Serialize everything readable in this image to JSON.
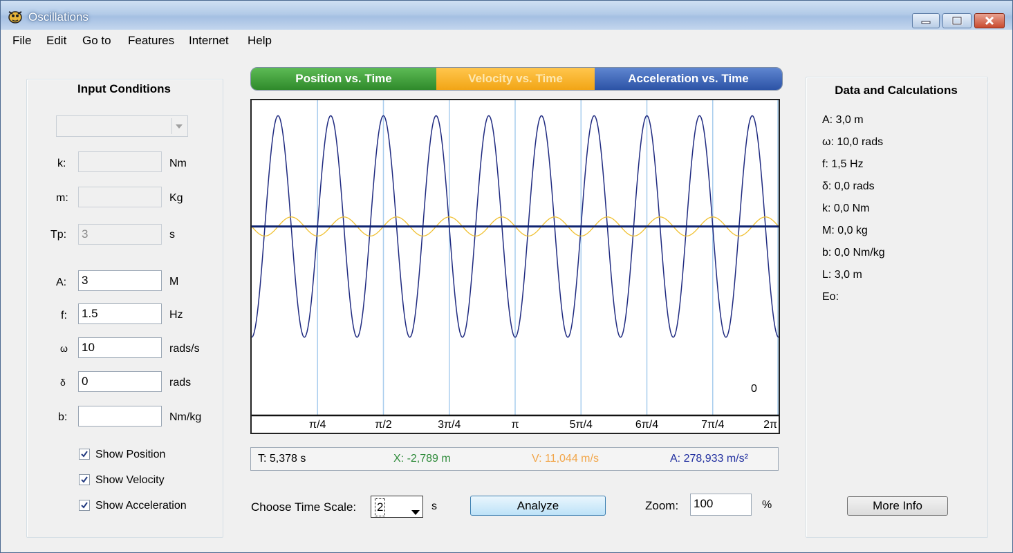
{
  "window": {
    "title": "Oscillations"
  },
  "menu": [
    "File",
    "Edit",
    "Go to",
    "Features",
    "Internet",
    "Help"
  ],
  "input_panel": {
    "title": "Input Conditions",
    "fields": [
      {
        "label": "k:",
        "value": "",
        "unit": "Nm"
      },
      {
        "label": "m:",
        "value": "",
        "unit": "Kg"
      },
      {
        "label": "Tp:",
        "value": "3",
        "unit": "s"
      },
      {
        "label": "A:",
        "value": "3",
        "unit": "M"
      },
      {
        "label": "f:",
        "value": "1.5",
        "unit": "Hz"
      },
      {
        "label": "ω",
        "value": "10",
        "unit": "rads/s"
      },
      {
        "label": "δ",
        "value": "0",
        "unit": "rads"
      },
      {
        "label": "b:",
        "value": "",
        "unit": "Nm/kg"
      }
    ],
    "checkboxes": [
      {
        "label": "Show Position",
        "checked": true
      },
      {
        "label": "Show Velocity",
        "checked": true
      },
      {
        "label": "Show Acceleration",
        "checked": true
      }
    ]
  },
  "tabs": [
    {
      "label": "Position vs. Time",
      "color": "#3f9a3a"
    },
    {
      "label": "Velocity vs. Time",
      "color": "#f5b22a"
    },
    {
      "label": "Acceleration vs. Time",
      "color": "#3a5fb0"
    }
  ],
  "graph": {
    "corner_value": "0",
    "colors": {
      "acceleration": "#1f2a80",
      "velocity": "#f0c030",
      "axis": "#0f2470",
      "grid": "#a8cdee"
    }
  },
  "chart_data": {
    "type": "line",
    "x_tick_labels": [
      "π/4",
      "π/2",
      "3π/4",
      "π",
      "5π/4",
      "6π/4",
      "7π/4",
      "2π"
    ],
    "xlim": [
      0,
      6.283
    ],
    "series": [
      {
        "kind": "acceleration",
        "amplitude": 5.0,
        "cycles": 10,
        "phase_deg": 180
      },
      {
        "kind": "velocity",
        "amplitude": 0.43,
        "cycles": 10,
        "phase_deg": 90
      },
      {
        "kind": "position",
        "amplitude": 0.0
      }
    ],
    "ylim": [
      -8.5,
      5.7
    ]
  },
  "readout": {
    "t": "T: 5,378 s",
    "x": "X: -2,789 m",
    "v": "V: 11,044 m/s",
    "a": "A: 278,933 m/s²",
    "x_color": "#2e8b3a",
    "v_color": "#f2a64a",
    "a_color": "#2230a0"
  },
  "controls": {
    "time_scale_label": "Choose Time Scale:",
    "time_scale_value": "2",
    "time_scale_unit": "s",
    "analyze": "Analyze",
    "zoom_label": "Zoom:",
    "zoom_value": "100",
    "zoom_unit": "%",
    "more_info": "More Info"
  },
  "data_panel": {
    "title": "Data and Calculations",
    "lines": [
      "A: 3,0 m",
      "ω: 10,0 rads",
      "f: 1,5 Hz",
      "δ: 0,0 rads",
      "k: 0,0 Nm",
      "M: 0,0 kg",
      "b: 0,0 Nm/kg",
      "L: 3,0 m",
      "Eo:"
    ]
  }
}
